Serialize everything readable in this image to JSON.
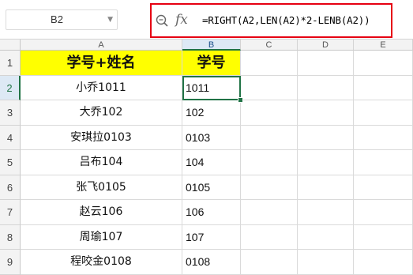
{
  "name_box": {
    "value": "B2"
  },
  "formula_bar": {
    "fx_label": "fx",
    "formula": "=RIGHT(A2,LEN(A2)*2-LENB(A2))",
    "highlight_color": "#e60012"
  },
  "columns": [
    "A",
    "B",
    "C",
    "D",
    "E"
  ],
  "selected_cell": "B2",
  "rows": [
    {
      "num": "1",
      "a": "学号+姓名",
      "b": "学号"
    },
    {
      "num": "2",
      "a": "小乔1011",
      "b": "1011"
    },
    {
      "num": "3",
      "a": "大乔102",
      "b": "102"
    },
    {
      "num": "4",
      "a": "安琪拉0103",
      "b": "0103"
    },
    {
      "num": "5",
      "a": "吕布104",
      "b": "104"
    },
    {
      "num": "6",
      "a": "张飞0105",
      "b": "0105"
    },
    {
      "num": "7",
      "a": "赵云106",
      "b": "106"
    },
    {
      "num": "8",
      "a": "周瑜107",
      "b": "107"
    },
    {
      "num": "9",
      "a": "程咬金0108",
      "b": "0108"
    }
  ],
  "colors": {
    "header_fill": "#ffff00",
    "selection": "#217346"
  }
}
